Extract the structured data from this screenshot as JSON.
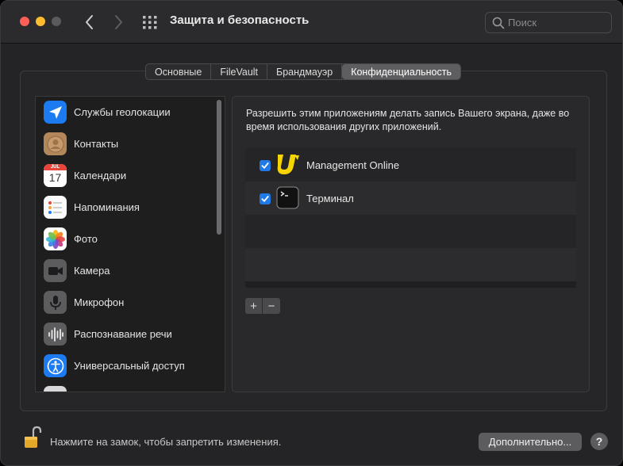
{
  "window": {
    "title": "Защита и безопасность"
  },
  "search": {
    "placeholder": "Поиск",
    "icon": "magnifying-glass-icon"
  },
  "tabs": [
    {
      "label": "Основные",
      "active": false
    },
    {
      "label": "FileVault",
      "active": false
    },
    {
      "label": "Брандмауэр",
      "active": false
    },
    {
      "label": "Конфиденциальность",
      "active": true
    }
  ],
  "sidebar": {
    "items": [
      {
        "label": "Службы геолокации",
        "icon": "location-arrow-icon"
      },
      {
        "label": "Контакты",
        "icon": "contacts-icon"
      },
      {
        "label": "Календари",
        "icon": "calendar-icon",
        "icon_month": "JUL",
        "icon_day": "17"
      },
      {
        "label": "Напоминания",
        "icon": "reminders-icon"
      },
      {
        "label": "Фото",
        "icon": "photos-icon"
      },
      {
        "label": "Камера",
        "icon": "camera-icon"
      },
      {
        "label": "Микрофон",
        "icon": "microphone-icon"
      },
      {
        "label": "Распознавание речи",
        "icon": "speech-recognition-icon"
      },
      {
        "label": "Универсальный доступ",
        "icon": "accessibility-icon"
      }
    ]
  },
  "content": {
    "description": "Разрешить этим приложениям делать запись Вашего экрана, даже во время использования других приложений.",
    "apps": [
      {
        "name": "Management Online",
        "checked": true,
        "icon": "management-online-logo-icon"
      },
      {
        "name": "Терминал",
        "checked": true,
        "icon": "terminal-icon"
      }
    ],
    "add_label": "+",
    "remove_label": "−"
  },
  "footer": {
    "lock_text": "Нажмите на замок, чтобы запретить изменения.",
    "advanced_label": "Дополнительно...",
    "help_label": "?"
  },
  "colors": {
    "accent": "#1f7ae8",
    "logo_yellow": "#f5d400"
  }
}
